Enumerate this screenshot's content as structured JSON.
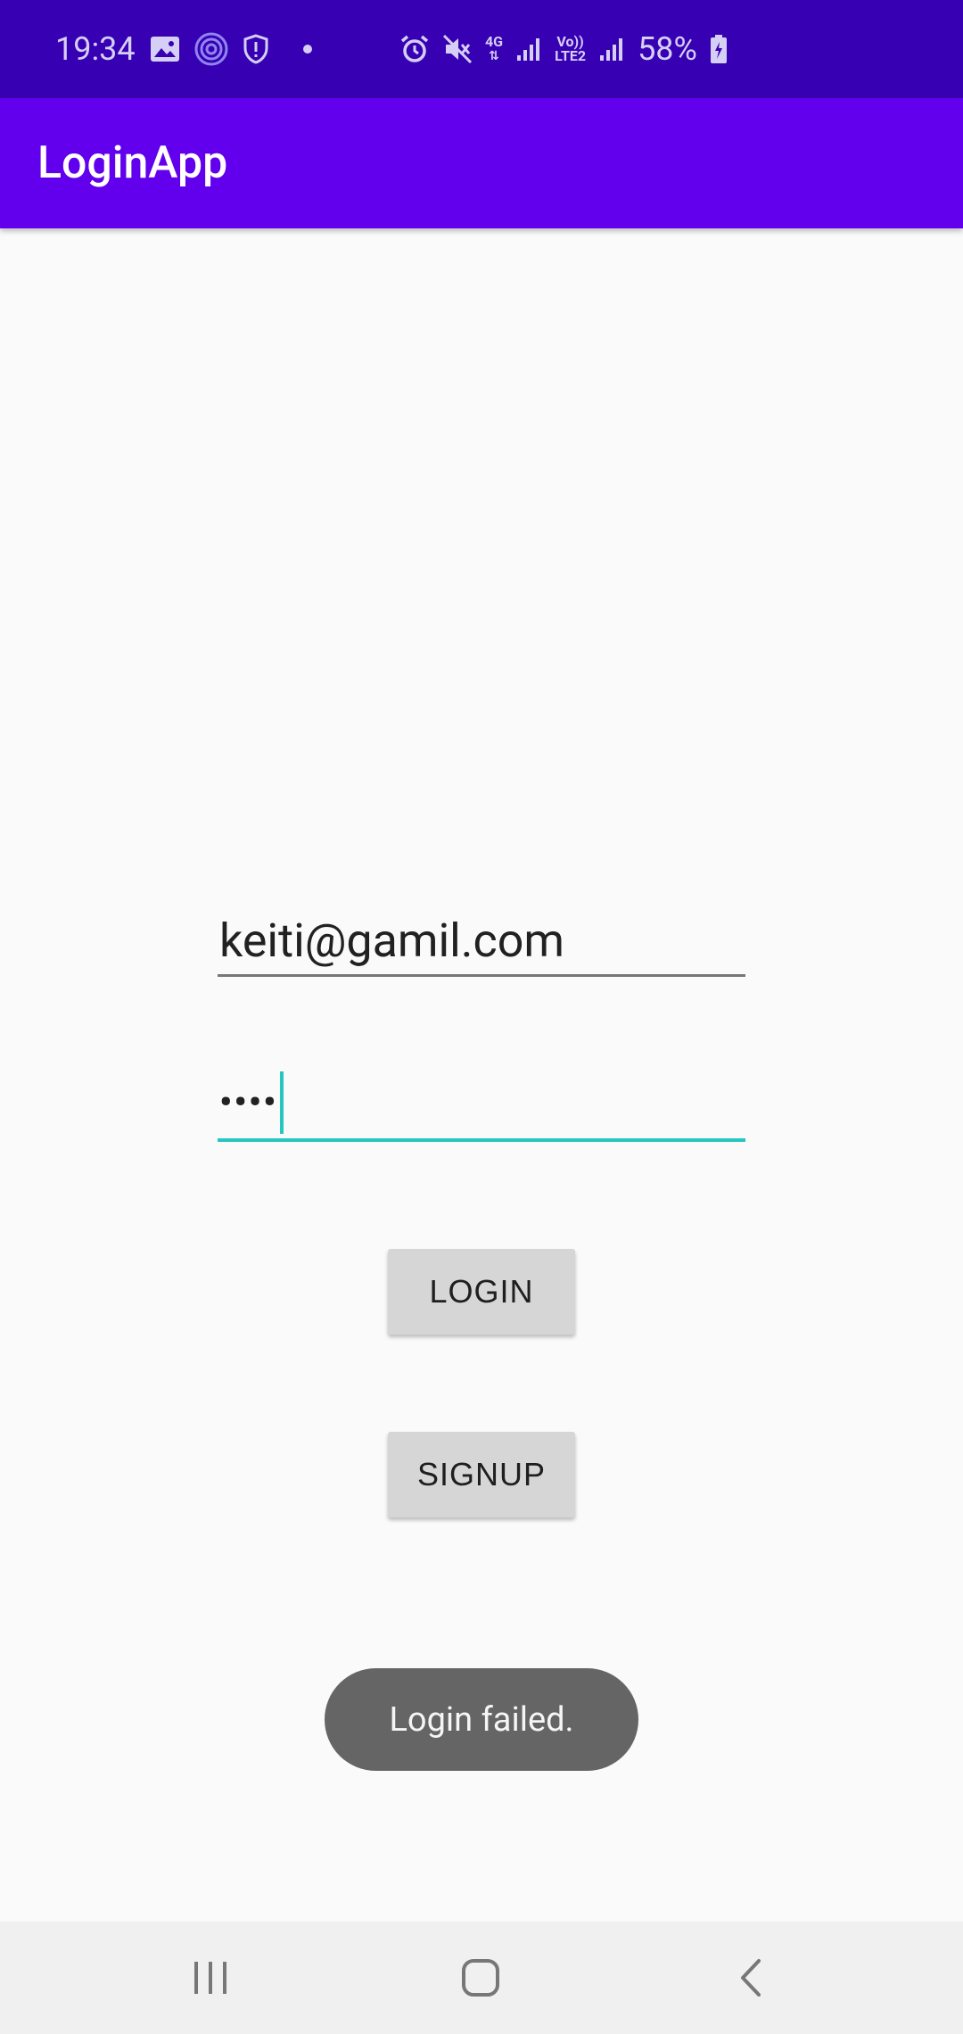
{
  "status_bar": {
    "time": "19:34",
    "network_type": "4G",
    "volte_label_top": "Vo))",
    "volte_label_bottom": "LTE2",
    "battery_percent": "58%"
  },
  "app_bar": {
    "title": "LoginApp"
  },
  "form": {
    "email_value": "keiti@gamil.com",
    "password_masked": "••••"
  },
  "buttons": {
    "login_label": "LOGIN",
    "signup_label": "SIGNUP"
  },
  "toast": {
    "message": "Login failed."
  },
  "colors": {
    "status_bar": "#3700b3",
    "app_bar": "#6200ee",
    "focus_accent": "#26c6c1",
    "toast_bg": "#656565"
  },
  "icons": {
    "status_left": [
      "image-icon",
      "wifi-calling-icon",
      "shield-icon"
    ],
    "status_right": [
      "alarm-icon",
      "mute-icon",
      "signal-icon",
      "signal-icon",
      "battery-charging-icon"
    ],
    "nav": [
      "recent-apps-icon",
      "home-icon",
      "back-icon"
    ]
  }
}
